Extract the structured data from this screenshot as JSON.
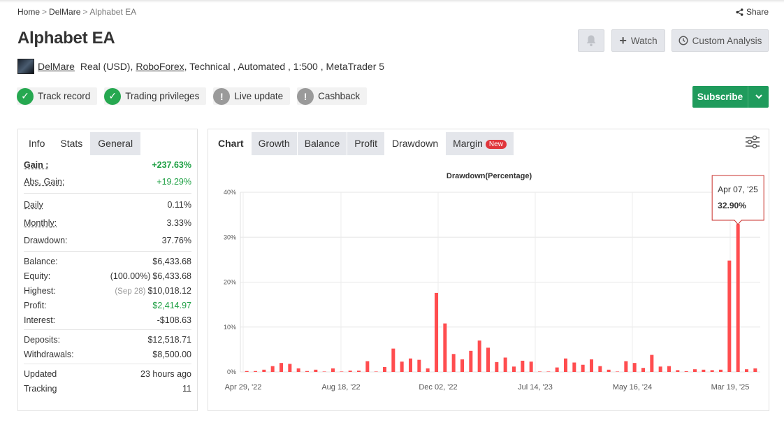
{
  "breadcrumb": {
    "home": "Home",
    "sep": ">",
    "user": "DelMare",
    "current": "Alphabet EA"
  },
  "share_label": "Share",
  "page_title": "Alphabet EA",
  "actions": {
    "watch": "Watch",
    "custom_analysis": "Custom Analysis"
  },
  "account": {
    "owner": "DelMare",
    "type": "Real (USD),",
    "broker": "RoboForex",
    "rest": ", Technical , Automated , 1:500 , MetaTrader 5"
  },
  "badges": [
    {
      "label": "Track record",
      "status": "ok"
    },
    {
      "label": "Trading privileges",
      "status": "ok"
    },
    {
      "label": "Live update",
      "status": "warn"
    },
    {
      "label": "Cashback",
      "status": "warn"
    }
  ],
  "subscribe_label": "Subscribe",
  "left_tabs": [
    "Info",
    "Stats",
    "General"
  ],
  "stats": {
    "gain": {
      "label": "Gain :",
      "value": "+237.63%"
    },
    "abs_gain": {
      "label": "Abs. Gain:",
      "value": "+19.29%"
    },
    "daily": {
      "label": "Daily",
      "value": "0.11%"
    },
    "monthly": {
      "label": "Monthly:",
      "value": "3.33%"
    },
    "drawdown": {
      "label": "Drawdown:",
      "value": "37.76%"
    },
    "balance": {
      "label": "Balance:",
      "value": "$6,433.68"
    },
    "equity": {
      "label": "Equity:",
      "pct": "(100.00%)",
      "value": "$6,433.68"
    },
    "highest": {
      "label": "Highest:",
      "date": "(Sep 28)",
      "value": "$10,018.12"
    },
    "profit": {
      "label": "Profit:",
      "value": "$2,414.97"
    },
    "interest": {
      "label": "Interest:",
      "value": "-$108.63"
    },
    "deposits": {
      "label": "Deposits:",
      "value": "$12,518.71"
    },
    "withdrawals": {
      "label": "Withdrawals:",
      "value": "$8,500.00"
    },
    "updated": {
      "label": "Updated",
      "value": "23 hours ago"
    },
    "tracking": {
      "label": "Tracking",
      "value": "11"
    }
  },
  "chart_tabs": [
    "Chart",
    "Growth",
    "Balance",
    "Profit",
    "Drawdown",
    "Margin"
  ],
  "new_badge": "New",
  "tooltip": {
    "date": "Apr 07, '25",
    "value": "32.90%"
  },
  "colors": {
    "green": "#1f9b5c",
    "bar": "#ff4d4f",
    "tooltip_border": "#c9302c"
  },
  "chart_data": {
    "type": "bar",
    "title": "Drawdown(Percentage)",
    "ylabel": "",
    "ylim": [
      0,
      40
    ],
    "yticks": [
      "0%",
      "10%",
      "20%",
      "30%",
      "40%"
    ],
    "xticks": [
      "Apr 29, '22",
      "Aug 18, '22",
      "Dec 02, '22",
      "Jul 14, '23",
      "May 16, '24",
      "Mar 19, '25"
    ],
    "grid": true,
    "values": [
      0.2,
      0.2,
      0.5,
      1.3,
      2.0,
      1.8,
      0.8,
      0.2,
      0.5,
      0,
      0.8,
      0,
      0.3,
      0.3,
      2.4,
      0,
      1.1,
      5.2,
      2.3,
      3.0,
      2.7,
      0.8,
      17.6,
      10.8,
      4.0,
      2.8,
      4.7,
      7.0,
      5.4,
      2.2,
      3.2,
      1.2,
      2.5,
      2.3,
      0,
      0,
      1.0,
      3.0,
      2.1,
      1.6,
      2.8,
      1.3,
      0.5,
      0,
      2.4,
      2.0,
      0.9,
      3.8,
      1.2,
      1.3,
      0.4,
      0.1,
      0.6,
      0.5,
      0.4,
      0.5,
      24.8,
      32.9,
      0.6,
      0.8
    ]
  }
}
